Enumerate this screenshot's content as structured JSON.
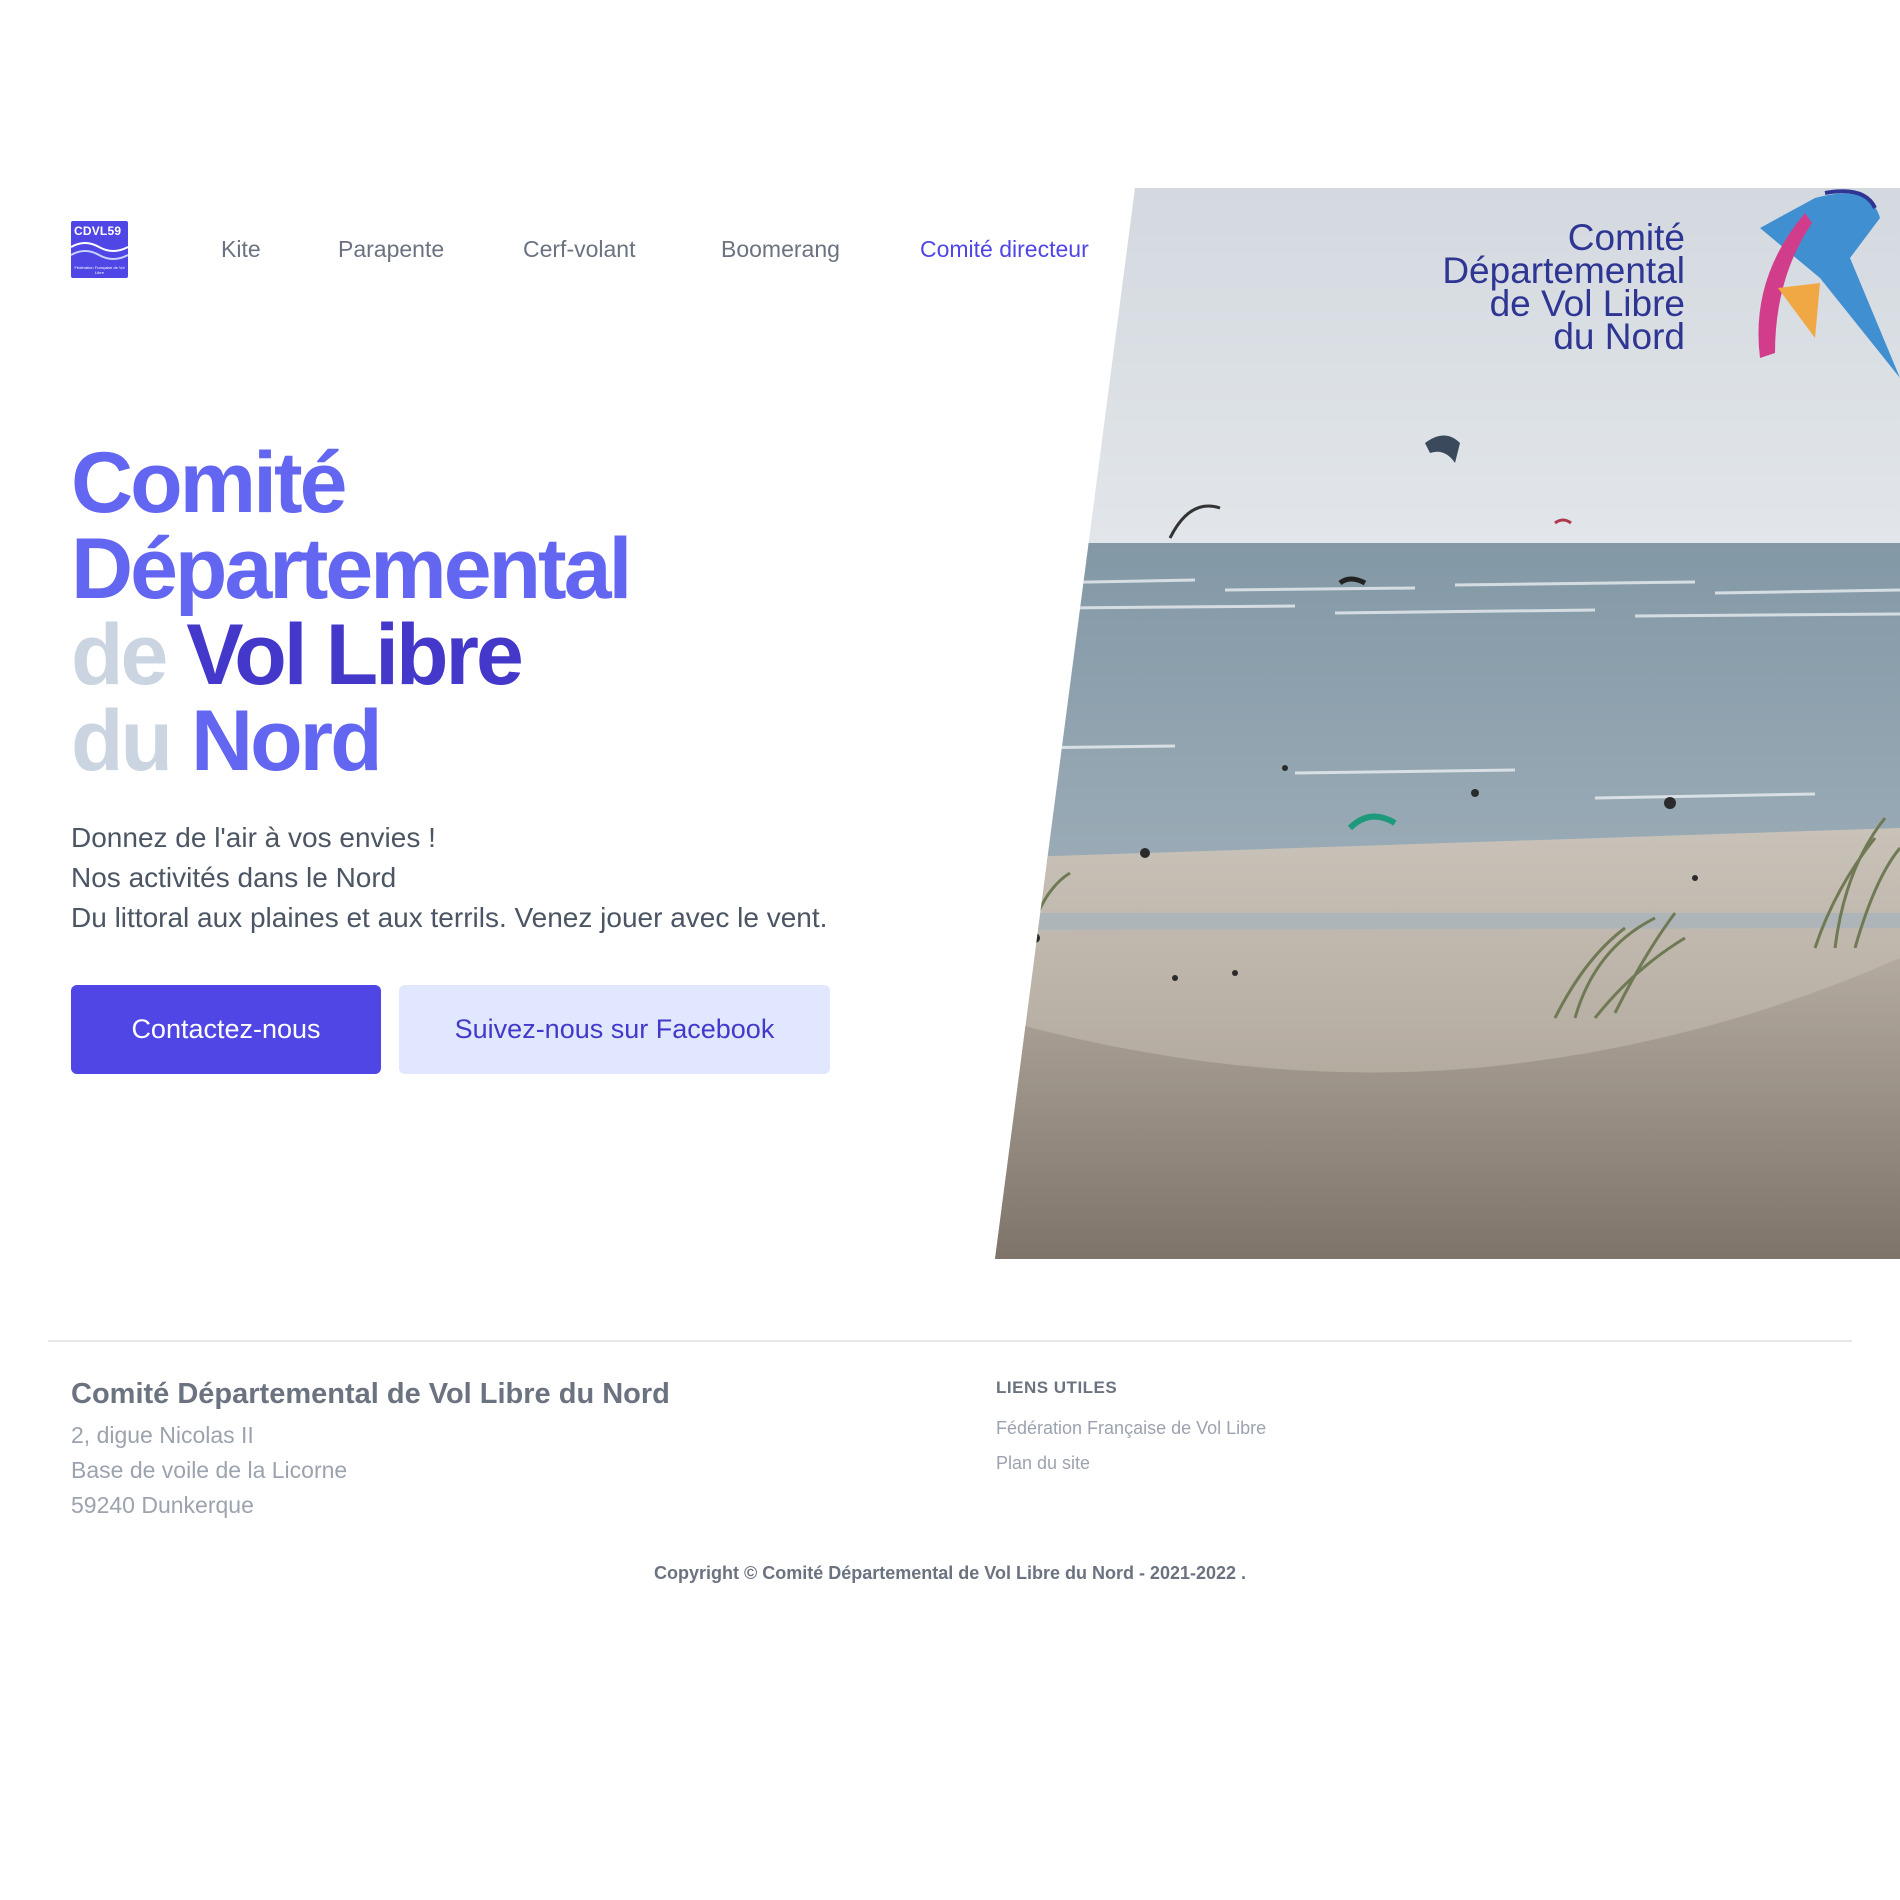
{
  "nav": {
    "logo_text": "CDVL59",
    "logo_subtext": "Fédération Française de Vol Libre",
    "items": [
      {
        "label": "Kite"
      },
      {
        "label": "Parapente"
      },
      {
        "label": "Cerf-volant"
      },
      {
        "label": "Boomerang"
      },
      {
        "label": "Comité directeur",
        "active": true
      }
    ]
  },
  "hero": {
    "title": {
      "line1": "Comité",
      "line2": "Départemental",
      "line3_a": "de",
      "line3_b": "Vol Libre",
      "line4_a": "du",
      "line4_b": "Nord"
    },
    "description": [
      "Donnez de l'air à vos envies !",
      "Nos activités dans le Nord",
      "Du littoral aux plaines et aux terrils. Venez jouer avec le vent."
    ],
    "buttons": {
      "primary": "Contactez-nous",
      "secondary": "Suivez-nous sur Facebook"
    },
    "image_logo": {
      "line1": "Comité",
      "line2": "Départemental",
      "line3": "de Vol Libre",
      "line4": "du Nord"
    }
  },
  "footer": {
    "org_name": "Comité Départemental de Vol Libre du Nord",
    "address": [
      "2, digue Nicolas II",
      "Base de voile de la Licorne",
      "59240 Dunkerque"
    ],
    "links_heading": "LIENS UTILES",
    "links": [
      "Fédération Française de Vol Libre",
      "Plan du site"
    ],
    "copyright": "Copyright © Comité Départemental de Vol Libre du Nord - 2021-2022 ."
  },
  "colors": {
    "accent": "#4f46e5",
    "accent_light": "#6366f1",
    "accent_dark": "#4338ca",
    "muted_title": "#cbd5e1",
    "secondary_button_bg": "#e0e7ff"
  }
}
